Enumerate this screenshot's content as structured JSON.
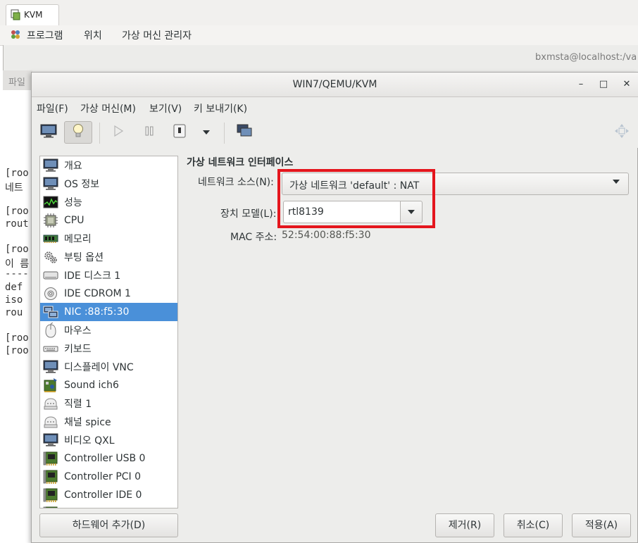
{
  "background_app": {
    "tab_label": "KVM",
    "menu": [
      "프로그램",
      "위치",
      "가상 머신 관리자"
    ],
    "user_host": "bxmsta@localhost:/va",
    "file_label": "파일",
    "terminal_lines": [
      "[roo",
      "네트",
      "",
      "[roo",
      "rout",
      "",
      "[roo",
      "이 름",
      "----",
      "def",
      "iso",
      "rou",
      "",
      "[roo",
      "[roo"
    ]
  },
  "dialog": {
    "title": "WIN7/QEMU/KVM",
    "window_controls": {
      "minimize": "–",
      "maximize": "□",
      "close": "✕"
    },
    "menu": {
      "file": "파일(F)",
      "vm": "가상 머신(M)",
      "view": "보기(V)",
      "sendkey": "키 보내기(K)"
    },
    "toolbar_icons": [
      "monitor-icon",
      "lightbulb-icon",
      "play-icon",
      "pause-icon",
      "power-icon",
      "dropdown-arrow-icon",
      "screens-icon",
      "fullscreen-icon"
    ],
    "hardware_list": [
      {
        "label": "개요",
        "icon": "monitor-icon",
        "selected": false
      },
      {
        "label": "OS 정보",
        "icon": "monitor-icon",
        "selected": false
      },
      {
        "label": "성능",
        "icon": "performance-icon",
        "selected": false
      },
      {
        "label": "CPU",
        "icon": "cpu-icon",
        "selected": false
      },
      {
        "label": "메모리",
        "icon": "memory-icon",
        "selected": false
      },
      {
        "label": "부팅 옵션",
        "icon": "gears-icon",
        "selected": false
      },
      {
        "label": "IDE 디스크 1",
        "icon": "disk-icon",
        "selected": false
      },
      {
        "label": "IDE CDROM 1",
        "icon": "cdrom-icon",
        "selected": false
      },
      {
        "label": "NIC :88:f5:30",
        "icon": "network-icon",
        "selected": true
      },
      {
        "label": "마우스",
        "icon": "mouse-icon",
        "selected": false
      },
      {
        "label": "키보드",
        "icon": "keyboard-icon",
        "selected": false
      },
      {
        "label": "디스플레이 VNC",
        "icon": "monitor-icon",
        "selected": false
      },
      {
        "label": "Sound ich6",
        "icon": "sound-icon",
        "selected": false
      },
      {
        "label": "직렬 1",
        "icon": "serial-icon",
        "selected": false
      },
      {
        "label": "채널 spice",
        "icon": "serial-icon",
        "selected": false
      },
      {
        "label": "비디오 QXL",
        "icon": "monitor-icon",
        "selected": false
      },
      {
        "label": "Controller USB 0",
        "icon": "controller-icon",
        "selected": false
      },
      {
        "label": "Controller PCI 0",
        "icon": "controller-icon",
        "selected": false
      },
      {
        "label": "Controller IDE 0",
        "icon": "controller-icon",
        "selected": false
      },
      {
        "label": "",
        "icon": "controller-icon",
        "selected": false
      }
    ],
    "details": {
      "section_title": "가상 네트워크 인터페이스",
      "network_source_label": "네트워크 소스(N):",
      "network_source_value": "가상 네트워크 'default' : NAT",
      "device_model_label": "장치 모델(L):",
      "device_model_value": "rtl8139",
      "mac_label": "MAC 주소:",
      "mac_value": "52:54:00:88:f5:30"
    },
    "buttons": {
      "add_hardware": "하드웨어 추가(D)",
      "remove": "제거(R)",
      "cancel": "취소(C)",
      "apply": "적용(A)"
    },
    "colors": {
      "selection": "#4a90d9",
      "highlight_box": "#e4161d"
    }
  }
}
